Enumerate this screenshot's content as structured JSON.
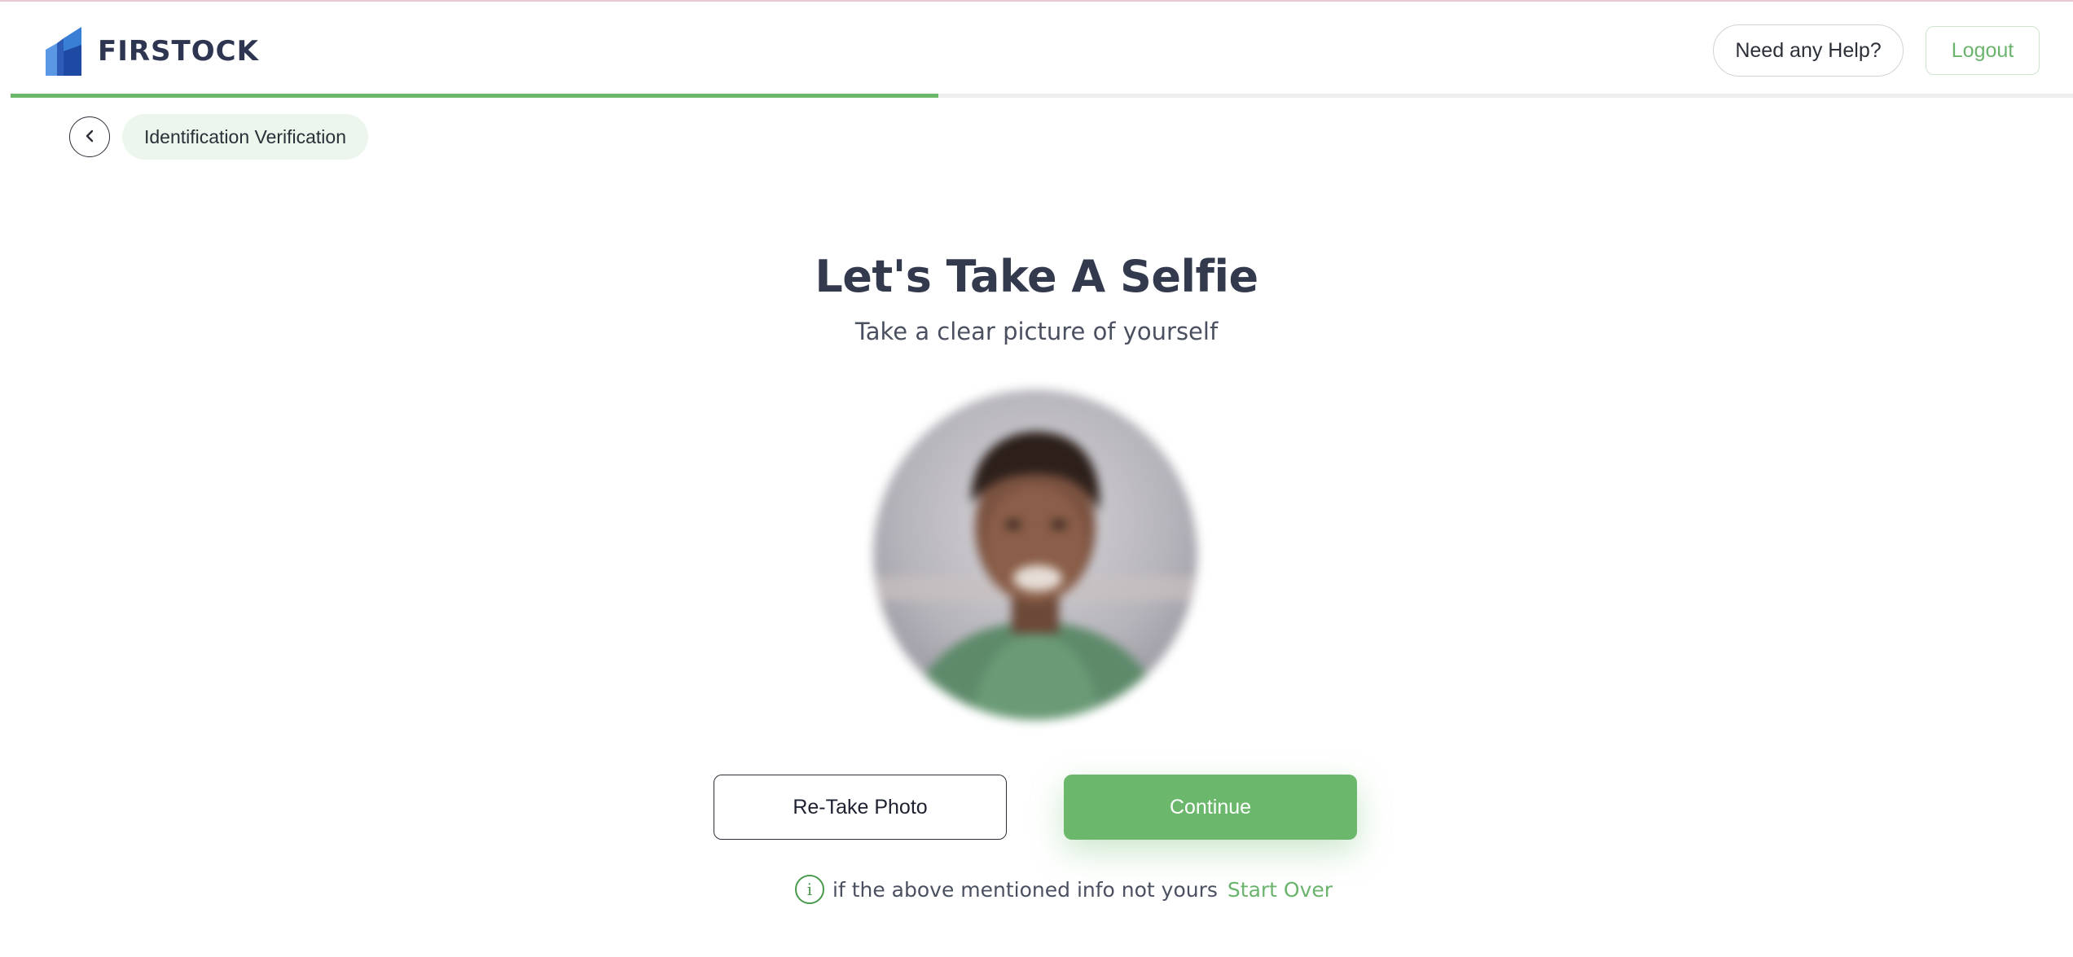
{
  "brand": {
    "name": "FIRSTOCK",
    "logo_icon": "building-logo-icon",
    "colors": {
      "primary": "#6bb86d",
      "dark_text": "#333a4d",
      "logo_blue": "#3a7fd6"
    }
  },
  "header": {
    "help_label": "Need any Help?",
    "logout_label": "Logout"
  },
  "progress": {
    "fraction": 0.45
  },
  "step": {
    "back_icon": "chevron-left-icon",
    "label": "Identification Verification"
  },
  "main": {
    "title": "Let's Take A Selfie",
    "subtitle": "Take a clear picture of yourself",
    "photo": "selfie-preview"
  },
  "actions": {
    "retake_label": "Re-Take Photo",
    "continue_label": "Continue"
  },
  "footer_note": {
    "icon": "info-icon",
    "text": "if the above mentioned info not yours",
    "link_label": "Start Over"
  }
}
